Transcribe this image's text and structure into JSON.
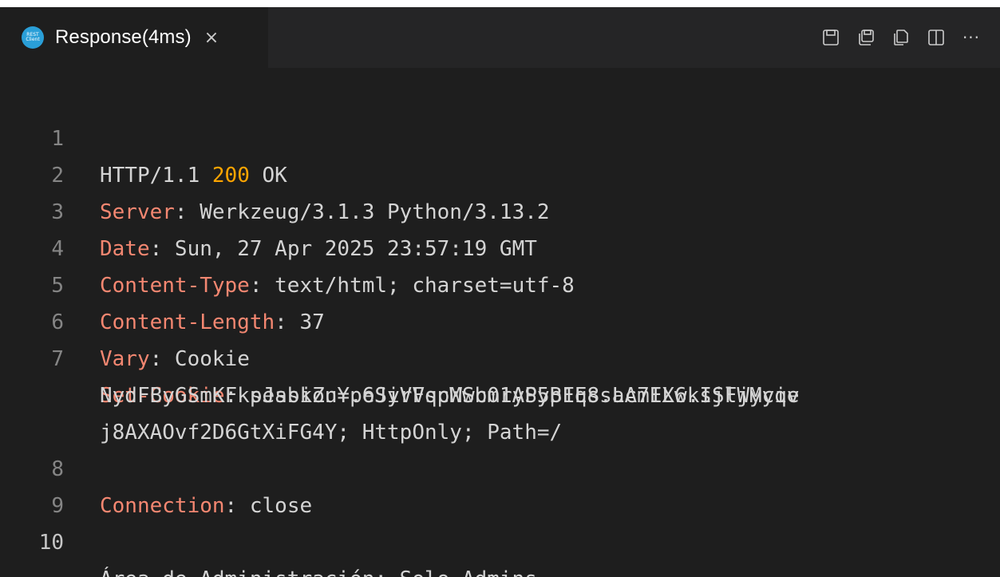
{
  "tab": {
    "icon_text": "REST Client",
    "title": "Response(4ms)",
    "close_glyph": "×"
  },
  "toolbar": {
    "icons": [
      "save-icon",
      "save-body-icon",
      "copy-icon",
      "split-editor-icon",
      "more-actions-icon"
    ],
    "more_label": "···"
  },
  "response": {
    "status_line": {
      "line": "1",
      "version": "HTTP/1.1",
      "code": "200",
      "text": "OK"
    },
    "headers": [
      {
        "line": "2",
        "name": "Server",
        "sep": ":",
        "value": " Werkzeug/3.1.3 Python/3.13.2"
      },
      {
        "line": "3",
        "name": "Date",
        "sep": ":",
        "value": " Sun, 27 Apr 2025 23:57:19 GMT"
      },
      {
        "line": "4",
        "name": "Content-Type",
        "sep": ":",
        "value": " text/html; charset=utf-8"
      },
      {
        "line": "5",
        "name": "Content-Length",
        "sep": ":",
        "value": " 37"
      },
      {
        "line": "6",
        "name": "Vary",
        "sep": ":",
        "value": " Cookie"
      },
      {
        "line": "7",
        "name": "Set-Cookie",
        "sep": ":",
        "value": " session=.eJyrVspMSc0rySyp1EssLcmIL6ksSFWyyiv",
        "wrap1": "NydFByGSmKFkpJabkZuYp6SiVFqcWwbm1AP5BFq8.aA7EXw.IjljMcqe",
        "wrap2": "j8AXAOvf2D6GtXiFG4Y; HttpOnly; Path=/"
      },
      {
        "line": "8",
        "name": "Connection",
        "sep": ":",
        "value": " close"
      }
    ],
    "blank_line": "9",
    "body": {
      "line": "10",
      "text": "Área de Administración: Solo Admins"
    }
  },
  "colors": {
    "background": "#1e1e1e",
    "tabbar": "#252526",
    "header_name": "#f48771",
    "status_code": "#ffa500",
    "text": "#d4d4d4",
    "line_number": "#858585",
    "icon_accent": "#2a9fd8"
  }
}
